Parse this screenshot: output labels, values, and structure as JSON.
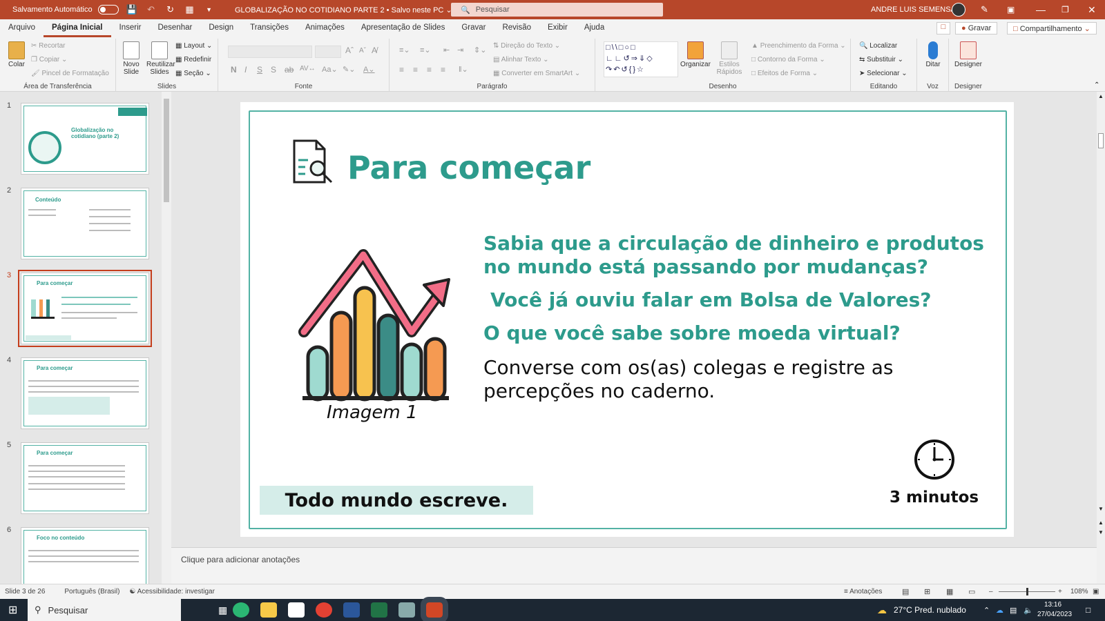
{
  "titlebar": {
    "autosave_label": "Salvamento Automático",
    "doc_title": "GLOBALIZAÇÃO NO COTIDIANO PARTE 2 • Salvo neste PC ⌄",
    "search_placeholder": "Pesquisar",
    "user_name": "ANDRE LUIS SEMENSATO"
  },
  "menu": {
    "tabs": [
      "Arquivo",
      "Página Inicial",
      "Inserir",
      "Desenhar",
      "Design",
      "Transições",
      "Animações",
      "Apresentação de Slides",
      "Gravar",
      "Revisão",
      "Exibir",
      "Ajuda"
    ],
    "gravar_button": "Gravar",
    "share_button": "Compartilhamento"
  },
  "ribbon": {
    "clipboard": {
      "paste": "Colar",
      "cut": "Recortar",
      "copy": "Copiar",
      "format_painter": "Pincel de Formatação",
      "label": "Área de Transferência"
    },
    "slides": {
      "new_slide": "Novo Slide",
      "reuse": "Reutilizar Slides",
      "layout": "Layout",
      "reset": "Redefinir",
      "section": "Seção",
      "label": "Slides"
    },
    "font": {
      "bold": "N",
      "italic": "I",
      "underline": "S",
      "strike": "S",
      "label": "Fonte"
    },
    "paragraph": {
      "text_direction": "Direção do Texto",
      "align_text": "Alinhar Texto",
      "smartart": "Converter em SmartArt",
      "label": "Parágrafo"
    },
    "drawing": {
      "arrange": "Organizar",
      "quick_styles": "Estilos Rápidos",
      "fill": "Preenchimento da Forma",
      "outline": "Contorno da Forma",
      "effects": "Efeitos de Forma",
      "label": "Desenho"
    },
    "editing": {
      "find": "Localizar",
      "replace": "Substituir",
      "select": "Selecionar",
      "label": "Editando"
    },
    "voice": {
      "dictate": "Ditar",
      "label": "Voz"
    },
    "designer": {
      "designer": "Designer",
      "label": "Designer"
    }
  },
  "thumbnails": [
    {
      "num": "1",
      "title": "Globalização no cotidiano (parte 2)"
    },
    {
      "num": "2",
      "title": "Conteúdo"
    },
    {
      "num": "3",
      "title": "Para começar"
    },
    {
      "num": "4",
      "title": "Para começar"
    },
    {
      "num": "5",
      "title": "Para começar"
    },
    {
      "num": "6",
      "title": "Foco no conteúdo"
    }
  ],
  "slide": {
    "title": "Para começar",
    "question1": "Sabia que a circulação de dinheiro e produtos no mundo está passando por mudanças?",
    "question2": "Você já ouviu falar em Bolsa de Valores?",
    "question3": "O que você sabe sobre moeda virtual?",
    "instruction": "Converse com os(as) colegas e registre as percepções no caderno.",
    "image_caption": "Imagem 1",
    "banner": "Todo mundo escreve.",
    "duration": "3 minutos"
  },
  "notes_placeholder": "Clique para adicionar anotações",
  "status": {
    "slide_counter": "Slide 3 de 26",
    "language": "Português (Brasil)",
    "accessibility": "Acessibilidade: investigar",
    "notes_btn": "Anotações",
    "zoom": "108%"
  },
  "taskbar": {
    "search": "Pesquisar",
    "weather": "27°C  Pred. nublado",
    "time": "13:16",
    "date": "27/04/2023"
  },
  "colors": {
    "accent": "#b7472a",
    "teal": "#2d9b8c",
    "banner_bg": "#d5ede9"
  }
}
